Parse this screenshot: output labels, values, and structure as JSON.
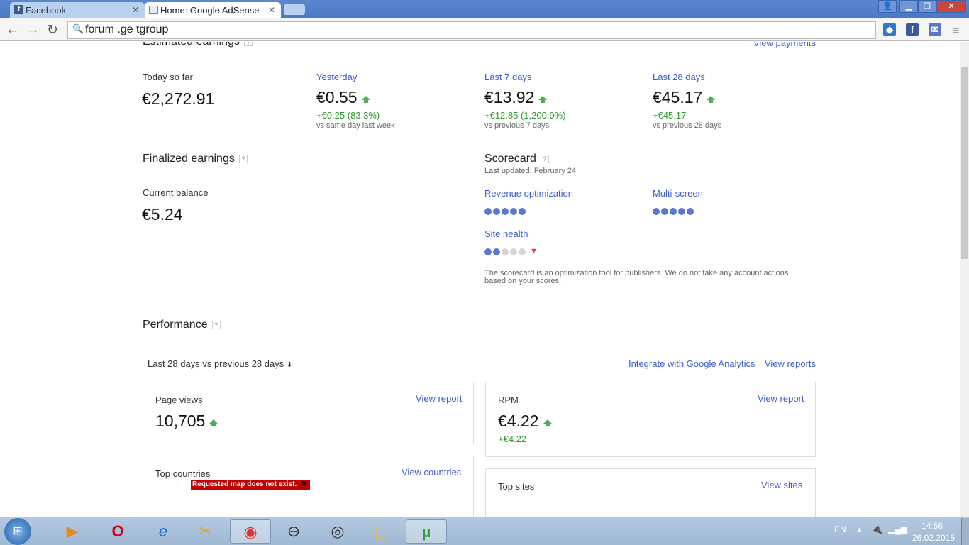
{
  "browser": {
    "tabs": [
      {
        "title": "Facebook",
        "active": false
      },
      {
        "title": "Home: Google AdSense",
        "active": true
      }
    ],
    "address": "forum .ge tgroup"
  },
  "estimated": {
    "title": "Estimated earnings",
    "view_payments": "View payments",
    "today": {
      "label": "Today so far",
      "value": "€2,272.91"
    },
    "periods": [
      {
        "label": "Yesterday",
        "value": "€0.55",
        "change": "+€0.25 (83.3%)",
        "compare": "vs same day last week"
      },
      {
        "label": "Last 7 days",
        "value": "€13.92",
        "change": "+€12.85 (1,200.9%)",
        "compare": "vs previous 7 days"
      },
      {
        "label": "Last 28 days",
        "value": "€45.17",
        "change": "+€45.17",
        "compare": "vs previous 28 days"
      }
    ]
  },
  "finalized": {
    "title": "Finalized earnings",
    "balance_label": "Current balance",
    "balance": "€5.24"
  },
  "scorecard": {
    "title": "Scorecard",
    "updated": "Last updated: February 24",
    "items": [
      {
        "label": "Revenue optimization",
        "score": 5
      },
      {
        "label": "Multi-screen",
        "score": 5
      },
      {
        "label": "Site health",
        "score": 2,
        "trend": "down"
      }
    ],
    "note": "The scorecard is an optimization tool for publishers. We do not take any account actions based on your scores."
  },
  "performance": {
    "title": "Performance",
    "range": "Last 28 days vs previous 28 days",
    "integrate": "Integrate with Google Analytics",
    "view_reports": "View reports",
    "page_views": {
      "label": "Page views",
      "link": "View report",
      "value": "10,705"
    },
    "rpm": {
      "label": "RPM",
      "link": "View report",
      "value": "€4.22",
      "change": "+€4.22"
    },
    "countries": {
      "label": "Top countries",
      "link": "View countries",
      "error": "Requested map does not exist."
    },
    "sites": {
      "label": "Top sites",
      "link": "View sites"
    }
  },
  "taskbar": {
    "lang": "EN",
    "time": "14:56",
    "date": "26.02.2015"
  }
}
